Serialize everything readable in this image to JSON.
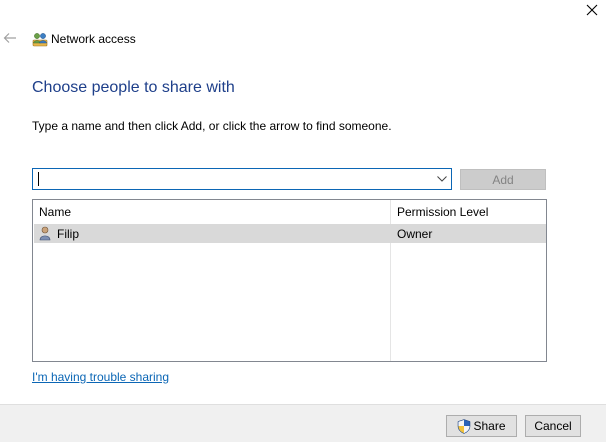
{
  "window": {
    "close_icon": "close-icon"
  },
  "nav": {
    "back_icon": "back-arrow-icon",
    "title": "Network access",
    "title_icon": "network-users-icon"
  },
  "content": {
    "heading": "Choose people to share with",
    "instruction": "Type a name and then click Add, or click the arrow to find someone.",
    "name_input": {
      "value": "",
      "placeholder": ""
    },
    "add_label": "Add",
    "table": {
      "columns": [
        "Name",
        "Permission Level"
      ],
      "rows": [
        {
          "name": "Filip",
          "permission": "Owner",
          "icon": "user-icon",
          "selected": true
        }
      ]
    },
    "trouble_link": "I'm having trouble sharing"
  },
  "footer": {
    "share_label": "Share",
    "share_icon": "uac-shield-icon",
    "cancel_label": "Cancel"
  },
  "colors": {
    "heading": "#1e3f8a",
    "link": "#0b66b5",
    "focus_border": "#0b66b5",
    "selected_row": "#d9d9d9",
    "footer_bg": "#f0f0f0"
  }
}
